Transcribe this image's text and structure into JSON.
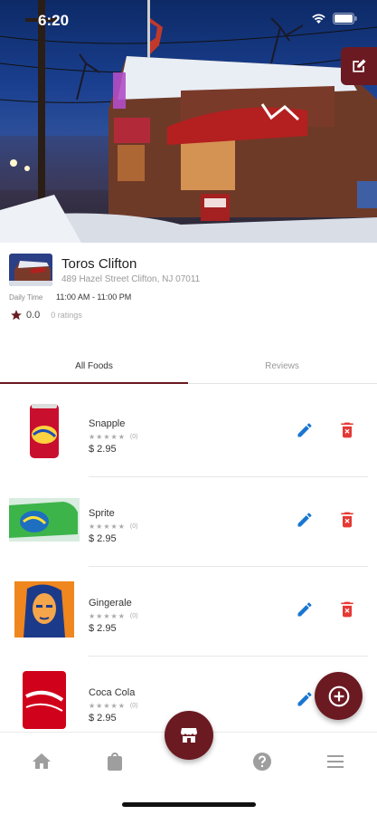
{
  "status_bar": {
    "time": "6:20"
  },
  "restaurant": {
    "name": "Toros Clifton",
    "address": "489 Hazel Street Clifton, NJ 07011",
    "hours_label": "Daily Time",
    "hours": "11:00 AM - 11:00 PM",
    "rating": "0.0",
    "rating_count": "0 ratings"
  },
  "tabs": [
    {
      "label": "All Foods",
      "active": true
    },
    {
      "label": "Reviews",
      "active": false
    }
  ],
  "foods": [
    {
      "name": "Snapple",
      "reviews": "(0)",
      "price": "$ 2.95",
      "icon": "snapple-can-image"
    },
    {
      "name": "Sprite",
      "reviews": "(0)",
      "price": "$ 2.95",
      "icon": "sprite-bottle-image"
    },
    {
      "name": "Gingerale",
      "reviews": "(0)",
      "price": "$ 2.95",
      "icon": "gingerale-can-image"
    },
    {
      "name": "Coca Cola",
      "reviews": "(0)",
      "price": "$ 2.95",
      "icon": "coca-cola-can-image"
    }
  ],
  "bottom_nav": [
    {
      "icon": "home-icon"
    },
    {
      "icon": "shopping-bag-icon"
    },
    {
      "icon": "store-icon"
    },
    {
      "icon": "help-icon"
    },
    {
      "icon": "menu-icon"
    }
  ],
  "colors": {
    "accent": "#6b1a22",
    "edit_blue": "#1976d2",
    "delete_red": "#e53935"
  }
}
